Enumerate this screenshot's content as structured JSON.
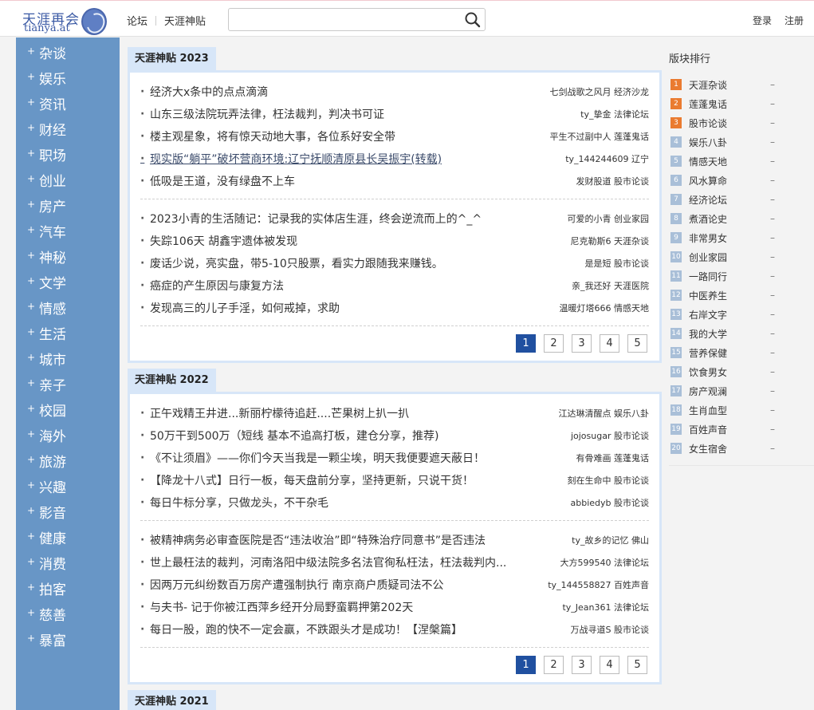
{
  "header": {
    "logo_cn": "天涯再会",
    "logo_en": "tianya.at",
    "nav": [
      "论坛",
      "天涯神贴"
    ],
    "search_placeholder": "",
    "login": "登录",
    "register": "注册"
  },
  "sidebar": {
    "items": [
      "杂谈",
      "娱乐",
      "资讯",
      "财经",
      "职场",
      "创业",
      "房产",
      "汽车",
      "神秘",
      "文学",
      "情感",
      "生活",
      "城市",
      "亲子",
      "校园",
      "海外",
      "旅游",
      "兴趣",
      "影音",
      "健康",
      "消费",
      "拍客",
      "慈善",
      "暴富"
    ]
  },
  "sections": [
    {
      "title": "天涯神贴 2023",
      "groups": [
        [
          {
            "title": "经济大x条中的点点滴滴",
            "meta": "七剑战歌之风月 经济沙龙"
          },
          {
            "title": "山东三级法院玩弄法律，枉法裁判，判决书可证",
            "meta": "ty_挚金 法律论坛"
          },
          {
            "title": "楼主观星象，将有惊天动地大事，各位系好安全带",
            "meta": "平生不过副中人 莲蓬鬼话"
          },
          {
            "title": "现实版“躺平”破坏营商环境:辽宁抚顺清原县长吴振宇(转载)",
            "meta": "ty_144244609 辽宁",
            "underline": true
          },
          {
            "title": "低吸是王道，没有绿盘不上车",
            "meta": "发财股道 股市论谈"
          }
        ],
        [
          {
            "title": "2023小青的生活随记：记录我的实体店生涯，终会逆流而上的^_^",
            "meta": "可爱的小青 创业家园"
          },
          {
            "title": "失踪106天 胡鑫宇遗体被发现",
            "meta": "尼克勒斯6 天涯杂谈"
          },
          {
            "title": "废话少说，亮实盘，带5-10只股票，看实力跟随我来赚钱。",
            "meta": "是是短 股市论谈"
          },
          {
            "title": "癌症的产生原因与康复方法",
            "meta": "亲_我还好 天涯医院"
          },
          {
            "title": "发现高三的儿子手淫，如何戒掉，求助",
            "meta": "温暖灯塔666 情感天地"
          }
        ]
      ],
      "pages": [
        "1",
        "2",
        "3",
        "4",
        "5"
      ]
    },
    {
      "title": "天涯神贴 2022",
      "groups": [
        [
          {
            "title": "正午戏精王井进...新丽柠檬待追赶....芒果树上扒一扒",
            "meta": "江达琳清醒点 娱乐八卦"
          },
          {
            "title": "50万干到500万（短线 基本不追高打板，建仓分享，推荐)",
            "meta": "jojosugar 股市论谈"
          },
          {
            "title": "《不让须眉》——你们今天当我是一颗尘埃，明天我便要遮天蔽日！",
            "meta": "有骨难画 莲蓬鬼话"
          },
          {
            "title": "【降龙十八式】日行一板，每天盘前分享，坚持更新，只说干货！",
            "meta": "刻在生命中 股市论谈"
          },
          {
            "title": "每日牛标分享，只做龙头，不干杂毛",
            "meta": "abbiedyb 股市论谈"
          }
        ],
        [
          {
            "title": "被精神病务必审查医院是否“违法收治”即“特殊治疗同意书”是否违法",
            "meta": "ty_故乡的记忆 佛山"
          },
          {
            "title": "世上最枉法的裁判，河南洛阳中级法院多名法官徇私枉法，枉法裁判内...",
            "meta": "大方599540 法律论坛"
          },
          {
            "title": "因两万元纠纷数百万房产遭强制执行 南京商户质疑司法不公",
            "meta": "ty_144558827 百姓声音"
          },
          {
            "title": "与夫书- 记于你被江西萍乡经开分局野蛮羁押第202天",
            "meta": "ty_Jean361 法律论坛"
          },
          {
            "title": "每日一股，跑的快不一定会赢，不跌跟头才是成功！【涅槃篇】",
            "meta": "万战寻道S 股市论谈"
          }
        ]
      ],
      "pages": [
        "1",
        "2",
        "3",
        "4",
        "5"
      ]
    },
    {
      "title": "天涯神贴 2021",
      "groups": [],
      "pages": []
    }
  ],
  "ranking": {
    "title": "版块排行",
    "items": [
      {
        "num": "1",
        "name": "天涯杂谈",
        "value": "–",
        "hot": true
      },
      {
        "num": "2",
        "name": "莲蓬鬼话",
        "value": "–",
        "hot": true
      },
      {
        "num": "3",
        "name": "股市论谈",
        "value": "–",
        "hot": true
      },
      {
        "num": "4",
        "name": "娱乐八卦",
        "value": "–"
      },
      {
        "num": "5",
        "name": "情感天地",
        "value": "–"
      },
      {
        "num": "6",
        "name": "风水算命",
        "value": "–"
      },
      {
        "num": "7",
        "name": "经济论坛",
        "value": "–"
      },
      {
        "num": "8",
        "name": "煮酒论史",
        "value": "–"
      },
      {
        "num": "9",
        "name": "非常男女",
        "value": "–"
      },
      {
        "num": "10",
        "name": "创业家园",
        "value": "–"
      },
      {
        "num": "11",
        "name": "一路同行",
        "value": "–"
      },
      {
        "num": "12",
        "name": "中医养生",
        "value": "–"
      },
      {
        "num": "13",
        "name": "右岸文字",
        "value": "–"
      },
      {
        "num": "14",
        "name": "我的大学",
        "value": "–"
      },
      {
        "num": "15",
        "name": "营养保健",
        "value": "–"
      },
      {
        "num": "16",
        "name": "饮食男女",
        "value": "–"
      },
      {
        "num": "17",
        "name": "房产观澜",
        "value": "–"
      },
      {
        "num": "18",
        "name": "生肖血型",
        "value": "–"
      },
      {
        "num": "19",
        "name": "百姓声音",
        "value": "–"
      },
      {
        "num": "20",
        "name": "女生宿舍",
        "value": "–"
      }
    ]
  }
}
